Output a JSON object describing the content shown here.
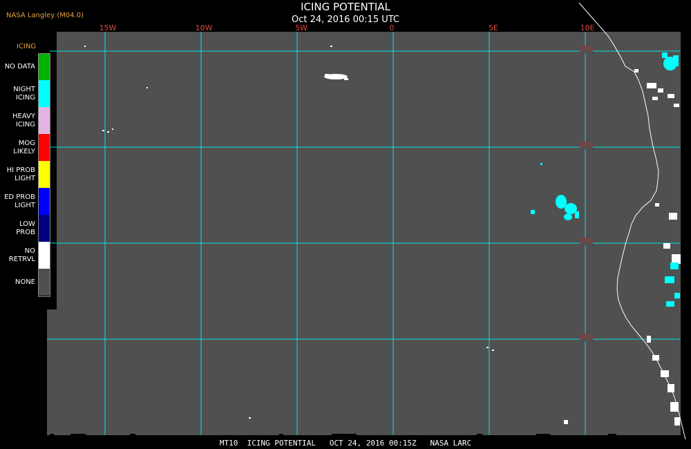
{
  "header": {
    "provider": "NASA Langley (M04.0)",
    "title": "ICING POTENTIAL",
    "datetime": "Oct 24, 2016 00:15 UTC"
  },
  "map": {
    "background_color": "#505050",
    "grid_color": "#00e5e5",
    "coastline_color": "#ffffff",
    "longitude_labels": [
      "15W",
      "10W",
      "5W",
      "0",
      "5E",
      "10E"
    ],
    "latitude_labels": [
      "15S",
      "20S",
      "25S",
      "30S"
    ]
  },
  "legend": {
    "title": "ICING",
    "items": [
      {
        "label": "NO DATA",
        "color": "#00b200"
      },
      {
        "label": "NIGHT\nICING",
        "color": "#00ffff"
      },
      {
        "label": "HEAVY\nICING",
        "color": "#e4b4e4"
      },
      {
        "label": "MOG\nLIKELY",
        "color": "#ff0000"
      },
      {
        "label": "HI PROB\nLIGHT",
        "color": "#ffff00"
      },
      {
        "label": "ED PROB\nLIGHT",
        "color": "#0000ff"
      },
      {
        "label": "LOW\nPROB",
        "color": "#000080"
      },
      {
        "label": "NO\nRETRVL",
        "color": "#ffffff"
      },
      {
        "label": "NONE",
        "color": "#505050"
      }
    ]
  },
  "footer": {
    "text": "MT10  ICING POTENTIAL   OCT 24, 2016 00:15Z   NASA LARC"
  }
}
